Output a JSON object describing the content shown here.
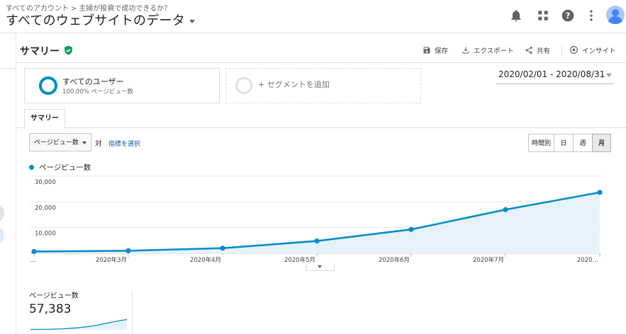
{
  "breadcrumb": {
    "account": "すべてのアカウント",
    "separator": ">",
    "property": "主婦が投資で成功できるか？"
  },
  "view_title": "すべてのウェブサイトのデータ",
  "topbar_icons": [
    "bell-icon",
    "apps-grid-icon",
    "help-icon",
    "more-vert-icon",
    "account-avatar-icon"
  ],
  "report": {
    "title": "サマリー",
    "verified_icon": "shield-check-icon"
  },
  "actions": {
    "save": "保存",
    "export": "エクスポート",
    "share": "共有",
    "insights": "インサイト"
  },
  "segments": {
    "active_name": "すべてのユーザー",
    "active_sub": "100.00% ページビュー数",
    "add_label": "+ セグメントを追加"
  },
  "date_range": "2020/02/01 - 2020/08/31",
  "tabs": [
    "サマリー"
  ],
  "controls": {
    "metric": "ページビュー数",
    "vs": "対",
    "select_metric": "指標を選択",
    "granularity": [
      "時間別",
      "日",
      "週",
      "月"
    ],
    "granularity_selected": "月"
  },
  "colors": {
    "series": "#058dc7",
    "fill": "#e6f2f9",
    "accent_green": "#0f9d58"
  },
  "chart_data": {
    "type": "area",
    "x": [
      "…",
      "2020年3月",
      "2020年4月",
      "2020年5月",
      "2020年6月",
      "2020年7月",
      "2020…"
    ],
    "series": [
      {
        "name": "ページビュー数",
        "values": [
          700,
          1000,
          2000,
          4800,
          9300,
          17000,
          23700
        ]
      }
    ],
    "yticks": [
      "30,000",
      "20,000",
      "10,000"
    ],
    "ylim": [
      0,
      30000
    ],
    "grid": true
  },
  "scorecard": {
    "label": "ページビュー数",
    "value": "57,383"
  }
}
